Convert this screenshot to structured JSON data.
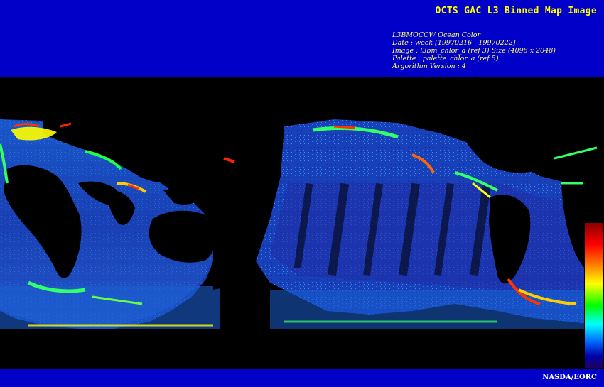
{
  "header": {
    "title": "OCTS GAC L3 Binned Map Image",
    "info_lines": [
      "L3BMOCCW Ocean Color",
      "Date : week [19970216 - 19970222]",
      "Image : l3bm_chlor_a (ref 3) Size (4096 x 2048)",
      "Palette : palette_chlor_a (ref 5)",
      "Argorithm Version : 4"
    ]
  },
  "footer": {
    "credit": "NASDA/EORC"
  },
  "colors": {
    "band": "#0000c8",
    "title_text": "#ffff00",
    "info_text": "#ffff66",
    "background": "#000000"
  }
}
